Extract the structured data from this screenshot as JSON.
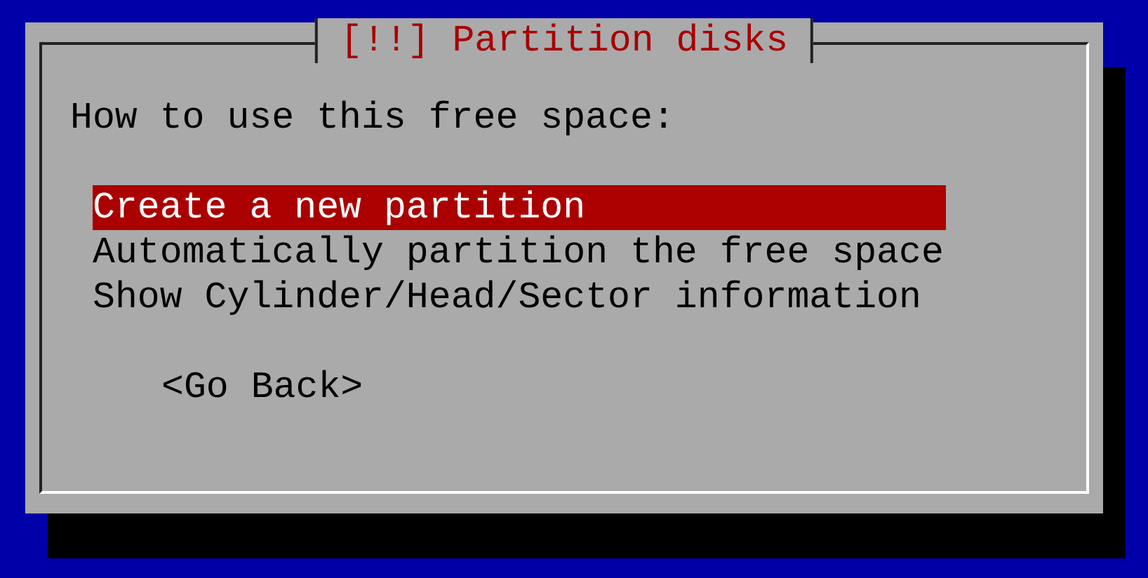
{
  "dialog": {
    "title": "[!!] Partition disks",
    "prompt": "How to use this free space:",
    "options": [
      {
        "label": "Create a new partition",
        "selected": true
      },
      {
        "label": "Automatically partition the free space",
        "selected": false
      },
      {
        "label": "Show Cylinder/Head/Sector information",
        "selected": false
      }
    ],
    "buttons": [
      {
        "label": "<Go Back>",
        "selected": false
      }
    ]
  }
}
